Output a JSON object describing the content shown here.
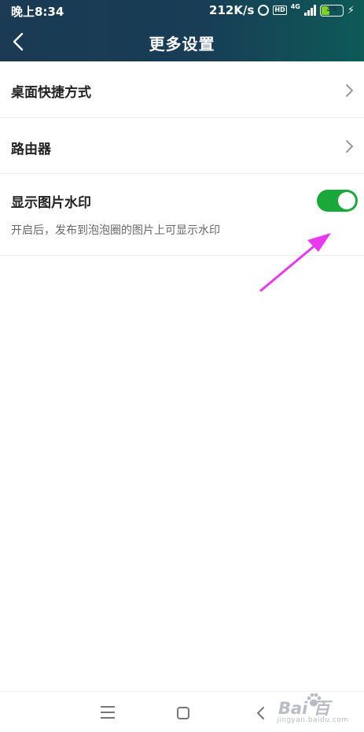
{
  "status_bar": {
    "time": "晚上8:34",
    "network_speed": "212K/s",
    "hd_badge": "HD",
    "network_type": "4G",
    "battery": "39",
    "battery_percent": 39
  },
  "header": {
    "title": "更多设置",
    "icons": {
      "back": "chevron-left-icon"
    }
  },
  "settings": {
    "desktop_shortcut": "桌面快捷方式",
    "router": "路由器",
    "watermark_label": "显示图片水印",
    "watermark_desc": "开启后，发布到泡泡圈的图片上可显示水印",
    "watermark_enabled": true
  },
  "colors": {
    "header_start": "#1b3a54",
    "header_end": "#0d5a57",
    "toggle_on": "#1aa83a",
    "annotation_arrow": "#e838f0"
  },
  "nav_bar": {
    "icons": [
      "menu-icon",
      "home-square-icon",
      "back-triangle-icon"
    ]
  },
  "watermark": {
    "logo": "Bai  百",
    "domain": "jingyan.baidu.com"
  }
}
